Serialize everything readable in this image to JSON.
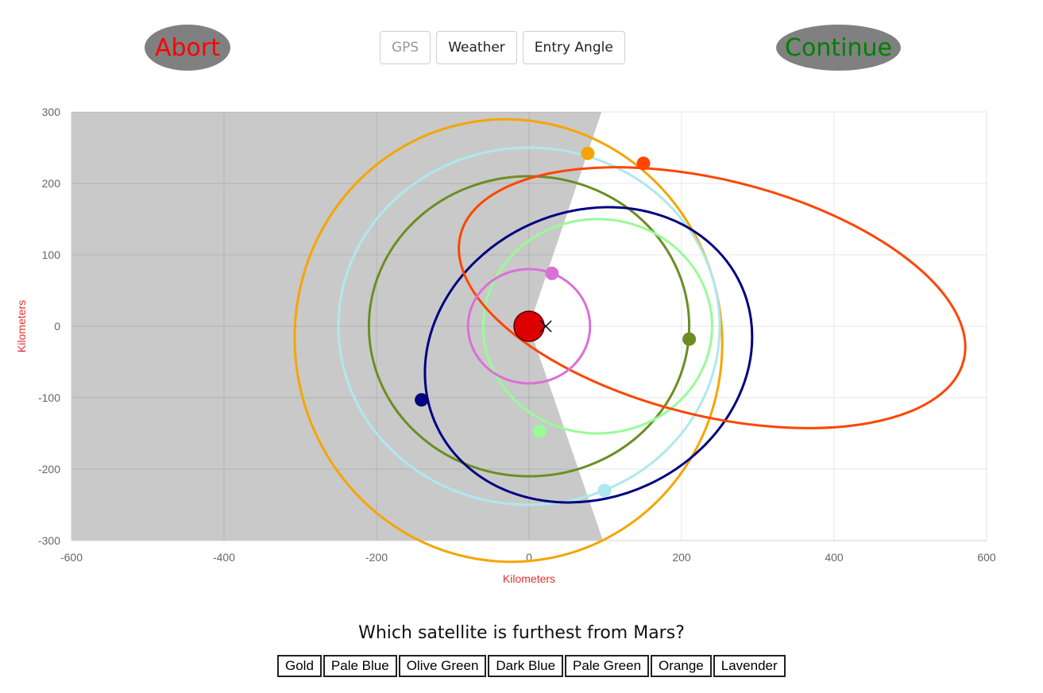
{
  "controls": {
    "abort_label": "Abort",
    "continue_label": "Continue",
    "tabs": [
      {
        "label": "GPS",
        "disabled": true
      },
      {
        "label": "Weather",
        "disabled": false
      },
      {
        "label": "Entry Angle",
        "disabled": false
      }
    ]
  },
  "chart_data": {
    "type": "scatter",
    "xlabel": "Kilometers",
    "ylabel": "Kilometers",
    "xlim": [
      -600,
      600
    ],
    "ylim": [
      -300,
      300
    ],
    "xticks": [
      -600,
      -400,
      -200,
      0,
      200,
      400,
      600
    ],
    "yticks": [
      300,
      200,
      100,
      0,
      -100,
      -200,
      -300
    ],
    "grid": true,
    "shadow": {
      "polygon": [
        [
          -600,
          300
        ],
        [
          95,
          300
        ],
        [
          0,
          0
        ],
        [
          97,
          -300
        ],
        [
          -600,
          -300
        ]
      ],
      "color": "#c9c9c9"
    },
    "planet": {
      "name": "Mars",
      "x": 0,
      "y": 0,
      "color": "#dd0000"
    },
    "target_marker": {
      "x": 22,
      "y": 0
    },
    "satellites": [
      {
        "name": "Gold",
        "color": "#f5a500",
        "orbit": {
          "cx": -27,
          "cy": -20,
          "rx": 280,
          "ry": 310,
          "rot": -10
        },
        "x": 77,
        "y": 242
      },
      {
        "name": "Pale Blue",
        "color": "#aee8ee",
        "orbit": {
          "cx": 0,
          "cy": 0,
          "rx": 250,
          "ry": 250,
          "rot": 0
        },
        "x": 99,
        "y": -230
      },
      {
        "name": "Olive Green",
        "color": "#6b8e23",
        "orbit": {
          "cx": 0,
          "cy": 0,
          "rx": 210,
          "ry": 210,
          "rot": 0
        },
        "x": 210,
        "y": -18
      },
      {
        "name": "Dark Blue",
        "color": "#000080",
        "orbit": {
          "cx": 78,
          "cy": -40,
          "rx": 220,
          "ry": 200,
          "rot": -25
        },
        "x": -141,
        "y": -103
      },
      {
        "name": "Pale Green",
        "color": "#98fb98",
        "orbit": {
          "cx": 90,
          "cy": 0,
          "rx": 150,
          "ry": 150,
          "rot": 0
        },
        "x": 14,
        "y": -147
      },
      {
        "name": "Orange",
        "color": "#ff4500",
        "orbit": {
          "cx": 240,
          "cy": 40,
          "rx": 340,
          "ry": 165,
          "rot": 14
        },
        "x": 150,
        "y": 228
      },
      {
        "name": "Lavender",
        "color": "#da70d6",
        "orbit": {
          "cx": 0,
          "cy": 0,
          "rx": 80,
          "ry": 80,
          "rot": 0
        },
        "x": 30,
        "y": 74
      }
    ]
  },
  "quiz": {
    "question": "Which satellite is furthest from Mars?",
    "answers": [
      "Gold",
      "Pale Blue",
      "Olive Green",
      "Dark Blue",
      "Pale Green",
      "Orange",
      "Lavender"
    ]
  }
}
